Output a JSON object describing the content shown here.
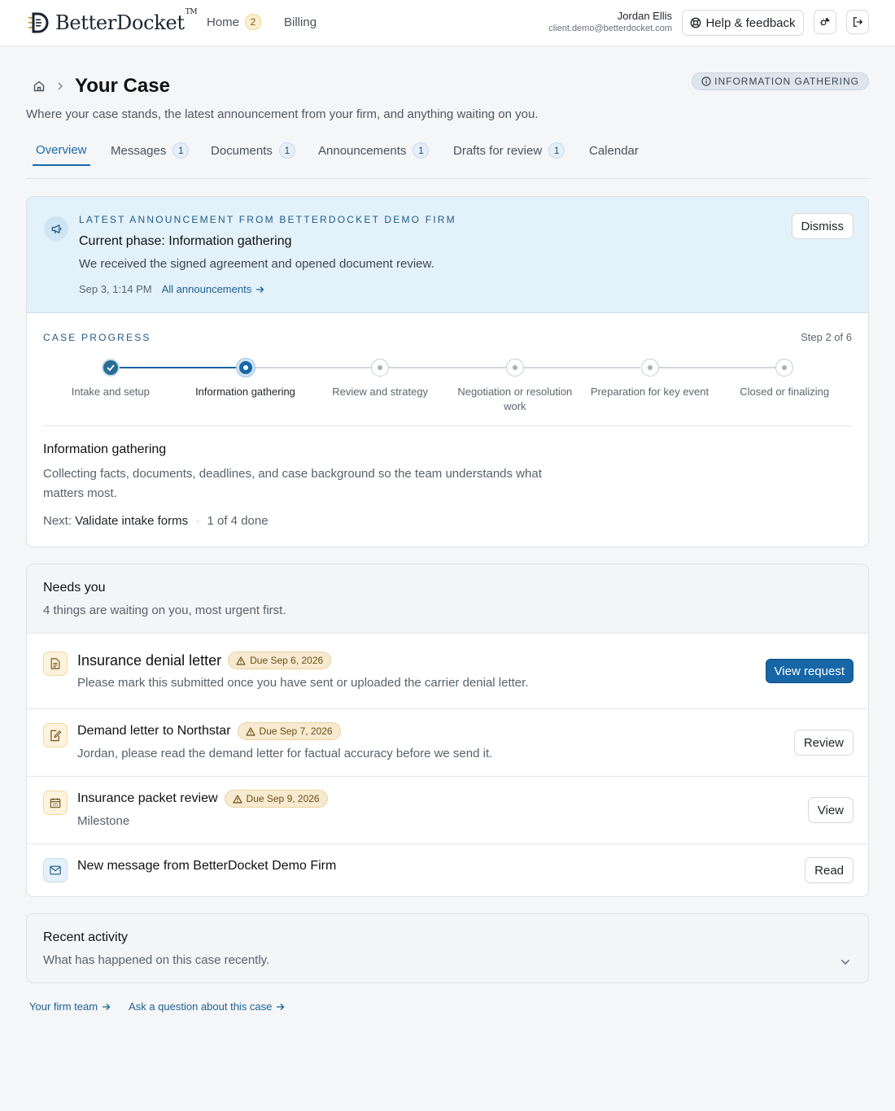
{
  "app": {
    "brand": "BetterDocket",
    "trademark": "TM",
    "nav": [
      {
        "label": "Home",
        "badge": "2"
      },
      {
        "label": "Billing"
      }
    ],
    "user": {
      "name": "Jordan Ellis",
      "email": "client.demo@betterdocket.com"
    },
    "help_label": "Help & feedback",
    "accent": "#1766a6"
  },
  "page": {
    "title": "Your Case",
    "subtitle": "Where your case stands, the latest announcement from your firm, and anything waiting on you.",
    "phase_pill": "INFORMATION GATHERING"
  },
  "tabs": [
    {
      "label": "Overview",
      "active": true
    },
    {
      "label": "Messages",
      "count": "1"
    },
    {
      "label": "Documents",
      "count": "1"
    },
    {
      "label": "Announcements",
      "count": "1"
    },
    {
      "label": "Drafts for review",
      "count": "1"
    },
    {
      "label": "Calendar"
    }
  ],
  "announcement": {
    "eyebrow": "LATEST ANNOUNCEMENT FROM BETTERDOCKET DEMO FIRM",
    "title": "Current phase: Information gathering",
    "body": "We received the signed agreement and opened document review.",
    "date": "Sep 3, 1:14 PM",
    "link": "All announcements",
    "dismiss": "Dismiss"
  },
  "progress": {
    "eyebrow": "CASE PROGRESS",
    "step_text": "Step 2 of 6",
    "current_step": 2,
    "steps": [
      "Intake and setup",
      "Information gathering",
      "Review and strategy",
      "Negotiation or resolution work",
      "Preparation for key event",
      "Closed or finalizing"
    ],
    "phase_title": "Information gathering",
    "phase_desc": "Collecting facts, documents, deadlines, and case background so the team understands what matters most.",
    "next_label": "Next:",
    "next_task": "Validate intake forms",
    "next_status": "1 of 4 done"
  },
  "needs_you": {
    "title": "Needs you",
    "subtitle": "4 things are waiting on you, most urgent first.",
    "items": [
      {
        "title": "Insurance denial letter",
        "due": "Due Sep 6, 2026",
        "desc": "Please mark this submitted once you have sent or uploaded the carrier denial letter.",
        "action": "View request",
        "icon": "document-icon"
      },
      {
        "title": "Demand letter to Northstar",
        "due": "Due Sep 7, 2026",
        "desc": "Jordan, please read the demand letter for factual accuracy before we send it.",
        "action": "Review",
        "icon": "edit-document-icon"
      },
      {
        "title": "Insurance packet review",
        "due": "Due Sep 9, 2026",
        "desc": "Milestone",
        "action": "View",
        "icon": "calendar-icon"
      },
      {
        "title": "New message from BetterDocket Demo Firm",
        "action": "Read",
        "icon": "mail-icon"
      }
    ]
  },
  "recent_activity": {
    "title": "Recent activity",
    "subtitle": "What has happened on this case recently."
  },
  "footer_links": [
    "Your firm team",
    "Ask a question about this case"
  ]
}
